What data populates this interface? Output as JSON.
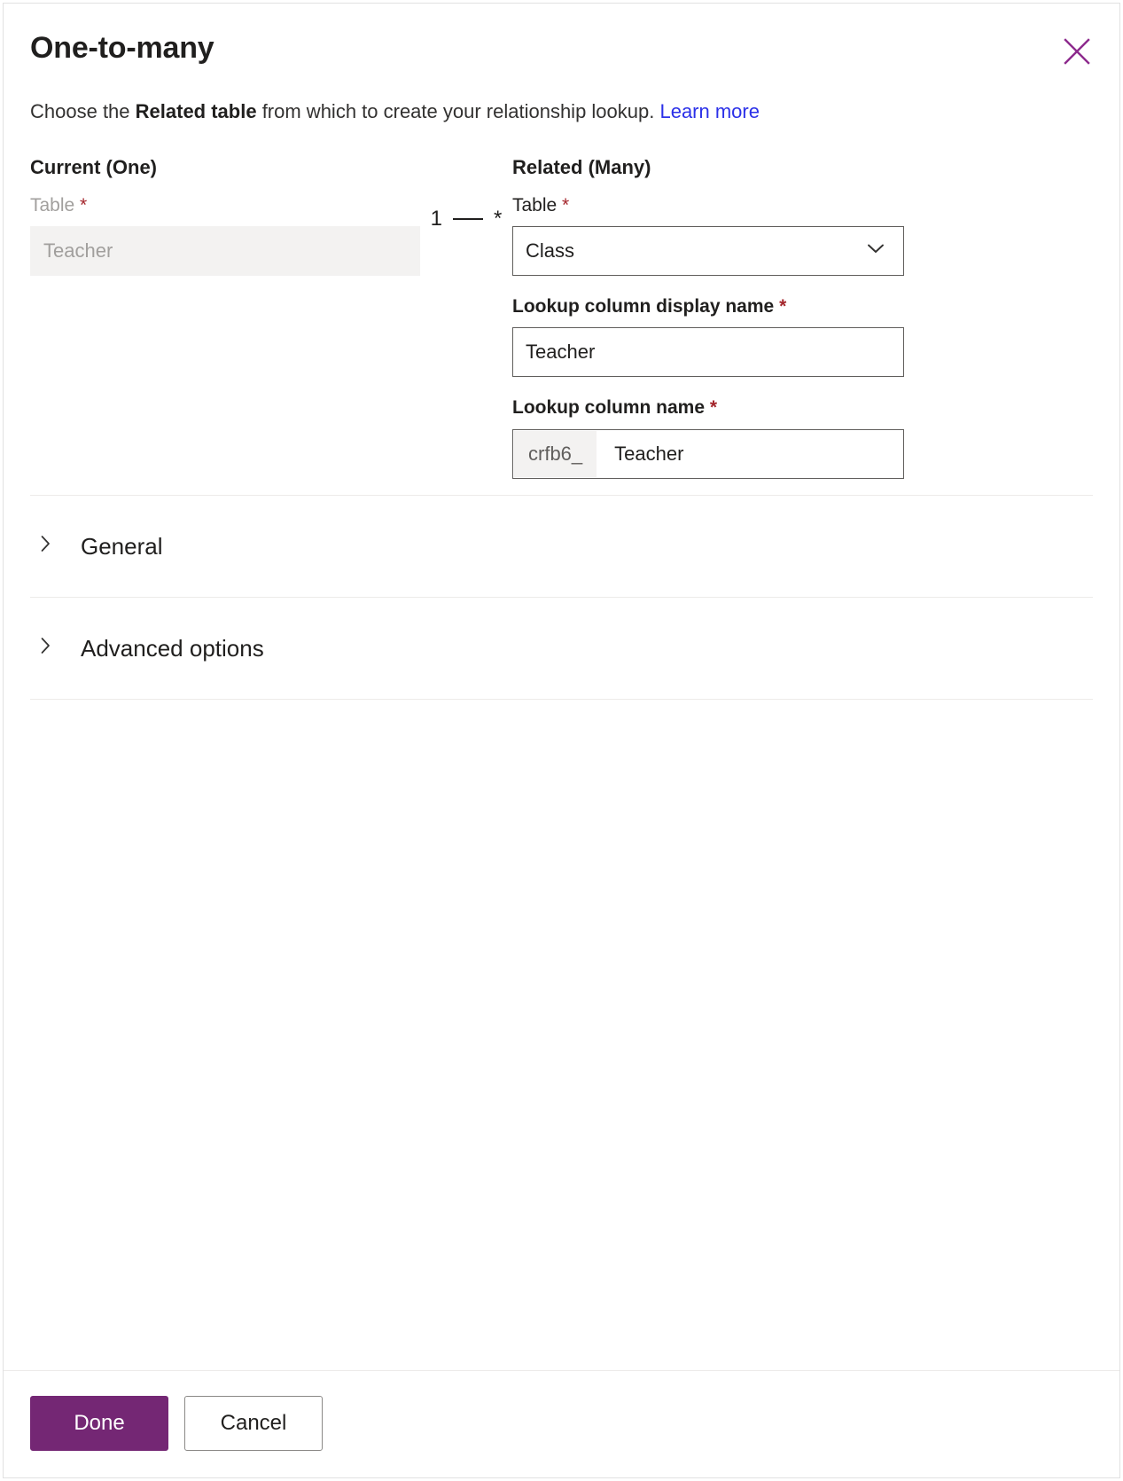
{
  "dialog": {
    "title": "One-to-many",
    "close_icon": "close-icon",
    "subtitle": {
      "before": "Choose the ",
      "strong": "Related table",
      "after": " from which to create your relationship lookup. ",
      "link": "Learn more"
    }
  },
  "current": {
    "heading": "Current (One)",
    "table_label": "Table",
    "table_required": "*",
    "table_value": "Teacher"
  },
  "connector": {
    "one": "1",
    "many": "*"
  },
  "related": {
    "heading": "Related (Many)",
    "table_label": "Table",
    "table_required": "*",
    "table_value": "Class",
    "table_chevron_icon": "chevron-down-icon",
    "display_name_label": "Lookup column display name",
    "display_name_required": "*",
    "display_name_value": "Teacher",
    "column_name_label": "Lookup column name",
    "column_name_required": "*",
    "column_name_prefix": "crfb6_",
    "column_name_value": "Teacher"
  },
  "accordions": [
    {
      "label": "General",
      "icon": "chevron-right-icon",
      "expanded": false
    },
    {
      "label": "Advanced options",
      "icon": "chevron-right-icon",
      "expanded": false
    }
  ],
  "footer": {
    "done_label": "Done",
    "cancel_label": "Cancel"
  },
  "colors": {
    "accent": "#742774",
    "link": "#2b30e8",
    "required": "#a4262c",
    "text": "#201f1e",
    "disabled_text": "#a19f9d",
    "disabled_bg": "#f3f2f1",
    "border": "#605e5c",
    "divider": "#edebe9"
  }
}
